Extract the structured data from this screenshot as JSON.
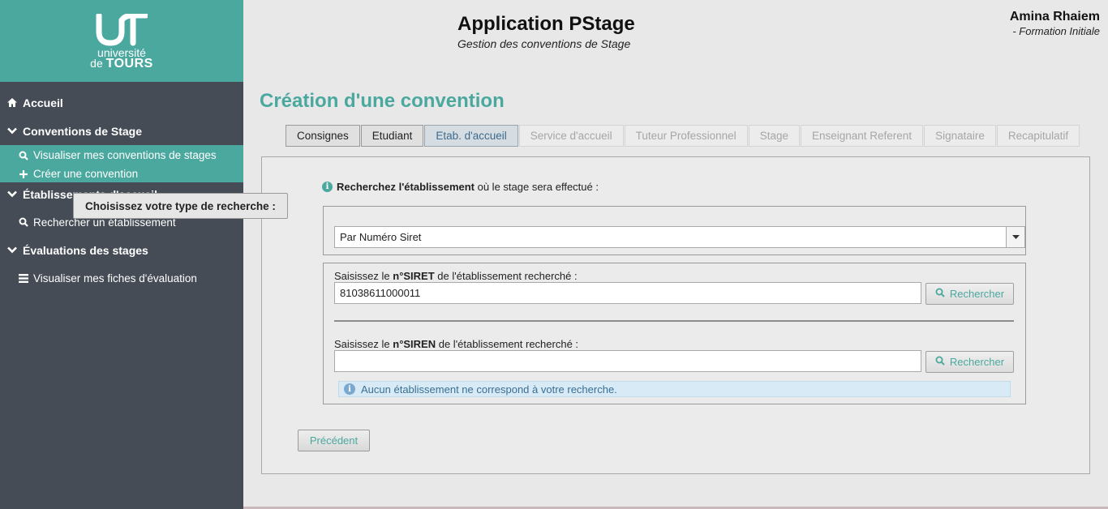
{
  "logo": {
    "line1": "université",
    "line2_prefix": "de",
    "line2_bold": "TOURS"
  },
  "header": {
    "title": "Application PStage",
    "subtitle": "Gestion des conventions de Stage",
    "user_name": "Amina Rhaiem",
    "user_role": "- Formation Initiale"
  },
  "sidebar": {
    "home": "Accueil",
    "conventions": "Conventions de Stage",
    "view_conventions": "Visualiser mes conventions de stages",
    "create_convention": "Créer une convention",
    "etablissements": "Établissements d'accueil",
    "search_etab": "Rechercher un établissement",
    "evaluations": "Évaluations des stages",
    "view_evals": "Visualiser mes fiches d'évaluation"
  },
  "page": {
    "title": "Création d'une convention"
  },
  "tabs": [
    {
      "label": "Consignes"
    },
    {
      "label": "Etudiant"
    },
    {
      "label": "Etab. d'accueil"
    },
    {
      "label": "Service d'accueil"
    },
    {
      "label": "Tuteur Professionnel"
    },
    {
      "label": "Stage"
    },
    {
      "label": "Enseignant Referent"
    },
    {
      "label": "Signataire"
    },
    {
      "label": "Recapitulatif"
    }
  ],
  "form": {
    "intro_bold": "Recherchez l'établissement",
    "intro_rest": " où le stage sera effectué :",
    "search_type_legend": "Choisissez votre type de recherche :",
    "search_type_value": "Par Numéro Siret",
    "siret_label_pre": "Saisissez le ",
    "siret_label_bold": "n°SIRET",
    "siret_label_post": " de l'établissement recherché :",
    "siret_value": "81038611000011",
    "siren_label_pre": "Saisissez le ",
    "siren_label_bold": "n°SIREN",
    "siren_label_post": " de l'établissement recherché :",
    "siren_value": "",
    "search_button": "Rechercher",
    "no_result": "Aucun établissement ne correspond à votre recherche.",
    "previous_button": "Précédent"
  },
  "colors": {
    "accent": "#4ba89f",
    "sidebar": "#454c55",
    "info": "#3a6f93"
  }
}
